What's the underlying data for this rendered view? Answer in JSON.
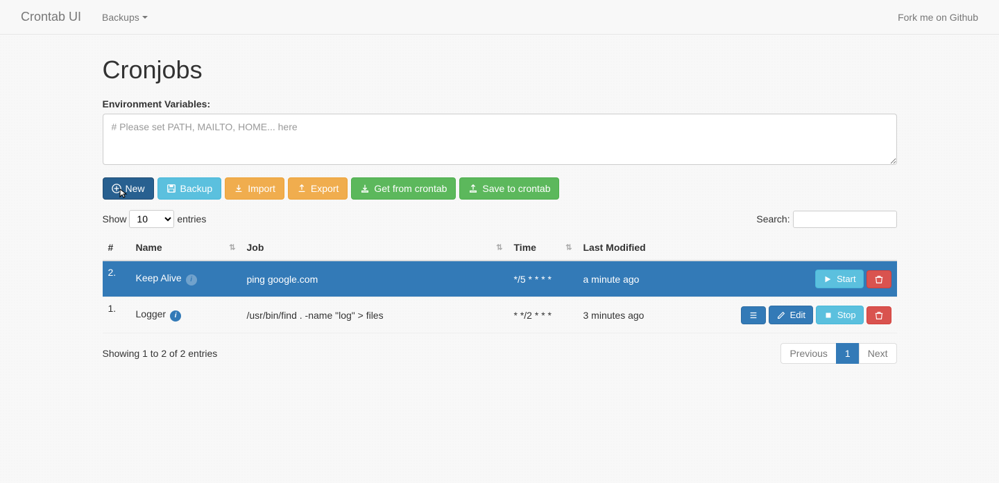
{
  "nav": {
    "brand": "Crontab UI",
    "backups": "Backups",
    "fork": "Fork me on Github"
  },
  "page": {
    "title": "Cronjobs",
    "env_label": "Environment Variables:",
    "env_placeholder": "# Please set PATH, MAILTO, HOME... here"
  },
  "toolbar": {
    "new": "New",
    "backup": "Backup",
    "import": "Import",
    "export": "Export",
    "get": "Get from crontab",
    "save": "Save to crontab"
  },
  "datatable": {
    "show_label": "Show",
    "entries_label": "entries",
    "length_value": "10",
    "search_label": "Search:",
    "columns": {
      "idx": "#",
      "name": "Name",
      "job": "Job",
      "time": "Time",
      "last_modified": "Last Modified"
    },
    "rows": [
      {
        "idx": "2.",
        "name": "Keep Alive",
        "job": "ping google.com",
        "time": "*/5 * * * *",
        "last_modified": "a minute ago",
        "selected": true,
        "stopped": true
      },
      {
        "idx": "1.",
        "name": "Logger",
        "job": "/usr/bin/find . -name \"log\" > files",
        "time": "* */2 * * *",
        "last_modified": "3 minutes ago",
        "selected": false,
        "stopped": false
      }
    ],
    "info_text": "Showing 1 to 2 of 2 entries",
    "prev": "Previous",
    "next": "Next",
    "page": "1"
  },
  "actions": {
    "start": "Start",
    "stop": "Stop",
    "edit": "Edit",
    "log": "Log",
    "delete": "Delete"
  }
}
